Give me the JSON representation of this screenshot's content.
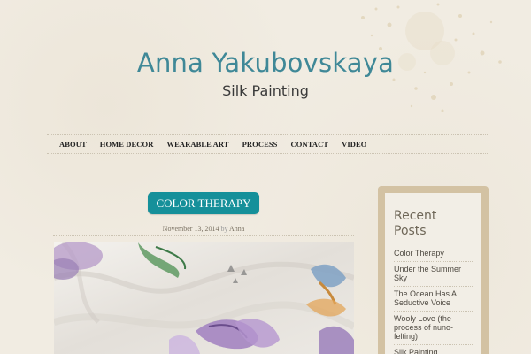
{
  "site": {
    "title": "Anna Yakubovskaya",
    "tagline": "Silk Painting"
  },
  "nav": {
    "items": [
      "ABOUT",
      "HOME DECOR",
      "WEARABLE ART",
      "PROCESS",
      "CONTACT",
      "VIDEO"
    ]
  },
  "post": {
    "title": "COLOR THERAPY",
    "date": "November 13, 2014",
    "by": "by",
    "author": "Anna"
  },
  "sidebar": {
    "widget_title": "Recent Posts",
    "recent_posts": [
      "Color Therapy",
      "Under the Summer Sky",
      "The Ocean Has A Seductive Voice",
      "Wooly Love (the process of nuno-felting)",
      "Silk Painting “Presence”"
    ]
  },
  "colors": {
    "background": "#f1ece2",
    "title": "#3f8897",
    "post_title_bg": "#15909a",
    "sidebar_frame": "#d3c2a3"
  }
}
